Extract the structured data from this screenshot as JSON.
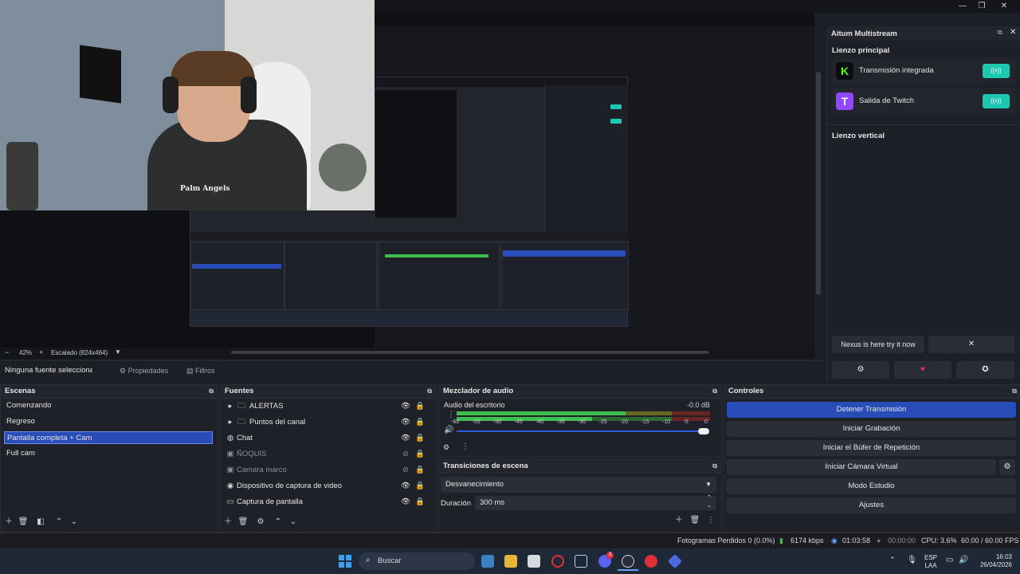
{
  "window": {
    "controls": [
      "—",
      "❐",
      "✕"
    ]
  },
  "preview": {
    "zoom": "42%",
    "scale_mode": "Escalado (824x464)",
    "zoom_minus": "−",
    "zoom_plus": "+"
  },
  "properties_bar": {
    "no_source": "Ninguna fuente seleccionad",
    "properties": "Propiedades",
    "filters": "Filtros"
  },
  "scenes": {
    "title": "Escenas",
    "items": [
      "Comenzando",
      "Regreso",
      "Pantalla completa + Cam",
      "Full cam"
    ],
    "selected_index": 2
  },
  "sources": {
    "title": "Fuentes",
    "items": [
      {
        "label": "ALERTAS",
        "icon": "folder-icon",
        "expandable": true,
        "visible": true
      },
      {
        "label": "Puntos del  canal",
        "icon": "folder-icon",
        "expandable": true,
        "visible": true
      },
      {
        "label": "Chat",
        "icon": "globe-icon",
        "expandable": false,
        "visible": true
      },
      {
        "label": "ÑOQUIS",
        "icon": "image-icon",
        "expandable": false,
        "visible": false
      },
      {
        "label": "Camara marco",
        "icon": "image-icon",
        "expandable": false,
        "visible": false
      },
      {
        "label": "Dispositivo de captura de video",
        "icon": "camera-icon",
        "expandable": false,
        "visible": true
      },
      {
        "label": "Captura de pantalla",
        "icon": "monitor-icon",
        "expandable": false,
        "visible": true
      }
    ]
  },
  "mixer": {
    "title": "Mezclador de audio",
    "channel": "Audio del escritorio",
    "db": "-0.0 dB",
    "ticks": [
      "-60",
      "-55",
      "-50",
      "-45",
      "-40",
      "-35",
      "-30",
      "-25",
      "-20",
      "-15",
      "-10",
      "-5",
      "0"
    ],
    "volume": 1.0
  },
  "transitions": {
    "title": "Transiciones de escena",
    "selected": "Desvanecimiento",
    "duration_label": "Duración",
    "duration_value": "300 ms"
  },
  "controls": {
    "title": "Controles",
    "buttons": [
      "Detener Transmisión",
      "Iniciar Grabación",
      "Iniciar el Búfer de Repetición",
      "Iniciar Cámara Virtual",
      "Modo Estudio",
      "Ajustes"
    ]
  },
  "multistream": {
    "title": "Aitum Multistream",
    "main_canvas": "Lienzo principal",
    "outputs": [
      {
        "name": "Transmisión integrada",
        "logo": "K",
        "logo_color": "#53fc18"
      },
      {
        "name": "Salida de Twitch",
        "logo": "T",
        "logo_color": "#9146ff"
      }
    ],
    "vertical_canvas": "Lienzo vertical",
    "nexus": "Nexus is here try it now",
    "nexus_close": "✕"
  },
  "statusbar": {
    "dropped": "Fotogramas Perdidos 0 (0.0%)",
    "bitrate": "6174 kbps",
    "stream_time": "01:03:58",
    "rec_time": "00:00:00",
    "cpu": "CPU: 3.6%",
    "fps": "60.00 / 60.00 FPS"
  },
  "taskbar": {
    "search": "Buscar",
    "lang_top": "ESP",
    "lang_bottom": "LAA",
    "time": "16:03",
    "date": "26/04/2026",
    "discord_badge": "3"
  },
  "webcam": {
    "hoodie_text": "Palm Angels"
  },
  "colors": {
    "accent": "#284cb8",
    "toggle_on": "#1ec8b0",
    "meter_green": "#3fbf4f",
    "meter_yellow": "#c8b02a",
    "meter_red": "#c0302f"
  }
}
